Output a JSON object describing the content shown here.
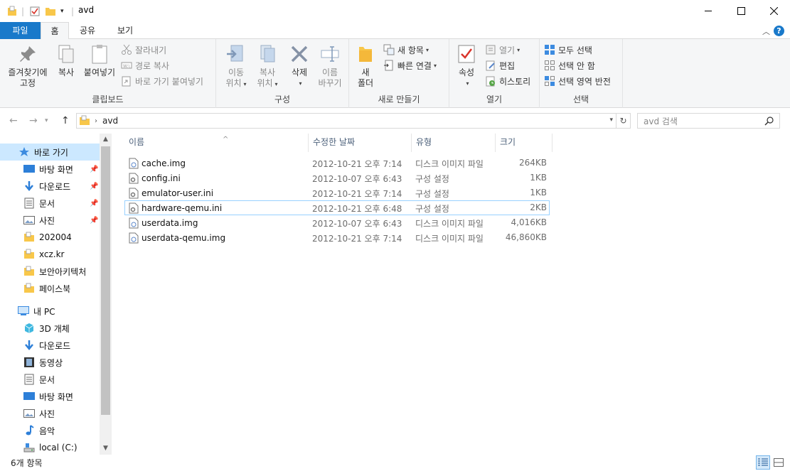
{
  "window": {
    "title": "avd"
  },
  "ribbon_tabs": [
    "파일",
    "홈",
    "공유",
    "보기"
  ],
  "ribbon": {
    "clipboard": {
      "label": "클립보드",
      "pin": [
        "즐겨찾기에",
        "고정"
      ],
      "copy": "복사",
      "paste": "붙여넣기",
      "cut": "잘라내기",
      "copy_path": "경로 복사",
      "paste_shortcut": "바로 가기 붙여넣기"
    },
    "organize": {
      "label": "구성",
      "move_to": [
        "이동",
        "위치"
      ],
      "copy_to": [
        "복사",
        "위치"
      ],
      "delete": "삭제",
      "rename": [
        "이름",
        "바꾸기"
      ]
    },
    "new": {
      "label": "새로 만들기",
      "new_folder": [
        "새",
        "폴더"
      ],
      "new_item": "새 항목",
      "easy_access": "빠른 연결"
    },
    "open": {
      "label": "열기",
      "properties": "속성",
      "open": "열기",
      "edit": "편집",
      "history": "히스토리"
    },
    "select": {
      "label": "선택",
      "select_all": "모두 선택",
      "select_none": "선택 안 함",
      "invert": "선택 영역 반전"
    }
  },
  "address": {
    "path": "avd",
    "search_placeholder": "avd 검색"
  },
  "navpane": {
    "quick_access": "바로 가기",
    "quick_items": [
      {
        "label": "바탕 화면",
        "icon": "desktop-icon",
        "pinned": true
      },
      {
        "label": "다운로드",
        "icon": "download-icon",
        "pinned": true
      },
      {
        "label": "문서",
        "icon": "document-icon",
        "pinned": true
      },
      {
        "label": "사진",
        "icon": "pictures-icon",
        "pinned": true
      },
      {
        "label": "202004",
        "icon": "folder-icon",
        "pinned": false
      },
      {
        "label": "xcz.kr",
        "icon": "folder-icon",
        "pinned": false
      },
      {
        "label": "보안아키텍처",
        "icon": "folder-icon",
        "pinned": false
      },
      {
        "label": "페이스북",
        "icon": "folder-icon",
        "pinned": false
      }
    ],
    "this_pc": "내 PC",
    "pc_items": [
      {
        "label": "3D 개체",
        "icon": "3d-objects-icon"
      },
      {
        "label": "다운로드",
        "icon": "download-icon"
      },
      {
        "label": "동영상",
        "icon": "video-icon"
      },
      {
        "label": "문서",
        "icon": "document-icon"
      },
      {
        "label": "바탕 화면",
        "icon": "desktop-icon"
      },
      {
        "label": "사진",
        "icon": "pictures-icon"
      },
      {
        "label": "음악",
        "icon": "music-icon"
      },
      {
        "label": "local (C:)",
        "icon": "drive-icon"
      }
    ]
  },
  "columns": {
    "name": "이름",
    "modified": "수정한 날짜",
    "type": "유형",
    "size": "크기"
  },
  "files": [
    {
      "name": "cache.img",
      "modified": "2012-10-21 오후 7:14",
      "type": "디스크 이미지 파일",
      "size": "264KB",
      "icon": "disk-image-file-icon"
    },
    {
      "name": "config.ini",
      "modified": "2012-10-07 오후 6:43",
      "type": "구성 설정",
      "size": "1KB",
      "icon": "config-file-icon"
    },
    {
      "name": "emulator-user.ini",
      "modified": "2012-10-21 오후 7:14",
      "type": "구성 설정",
      "size": "1KB",
      "icon": "config-file-icon"
    },
    {
      "name": "hardware-qemu.ini",
      "modified": "2012-10-21 오후 6:48",
      "type": "구성 설정",
      "size": "2KB",
      "icon": "config-file-icon"
    },
    {
      "name": "userdata.img",
      "modified": "2012-10-07 오후 6:43",
      "type": "디스크 이미지 파일",
      "size": "4,016KB",
      "icon": "disk-image-file-icon"
    },
    {
      "name": "userdata-qemu.img",
      "modified": "2012-10-21 오후 7:14",
      "type": "디스크 이미지 파일",
      "size": "46,860KB",
      "icon": "disk-image-file-icon"
    }
  ],
  "status": {
    "count": "6개 항목"
  },
  "colors": {
    "accent": "#1979ca",
    "selection": "#cce8ff",
    "focus_border": "#99d1ff",
    "folder": "#f8c74a"
  }
}
